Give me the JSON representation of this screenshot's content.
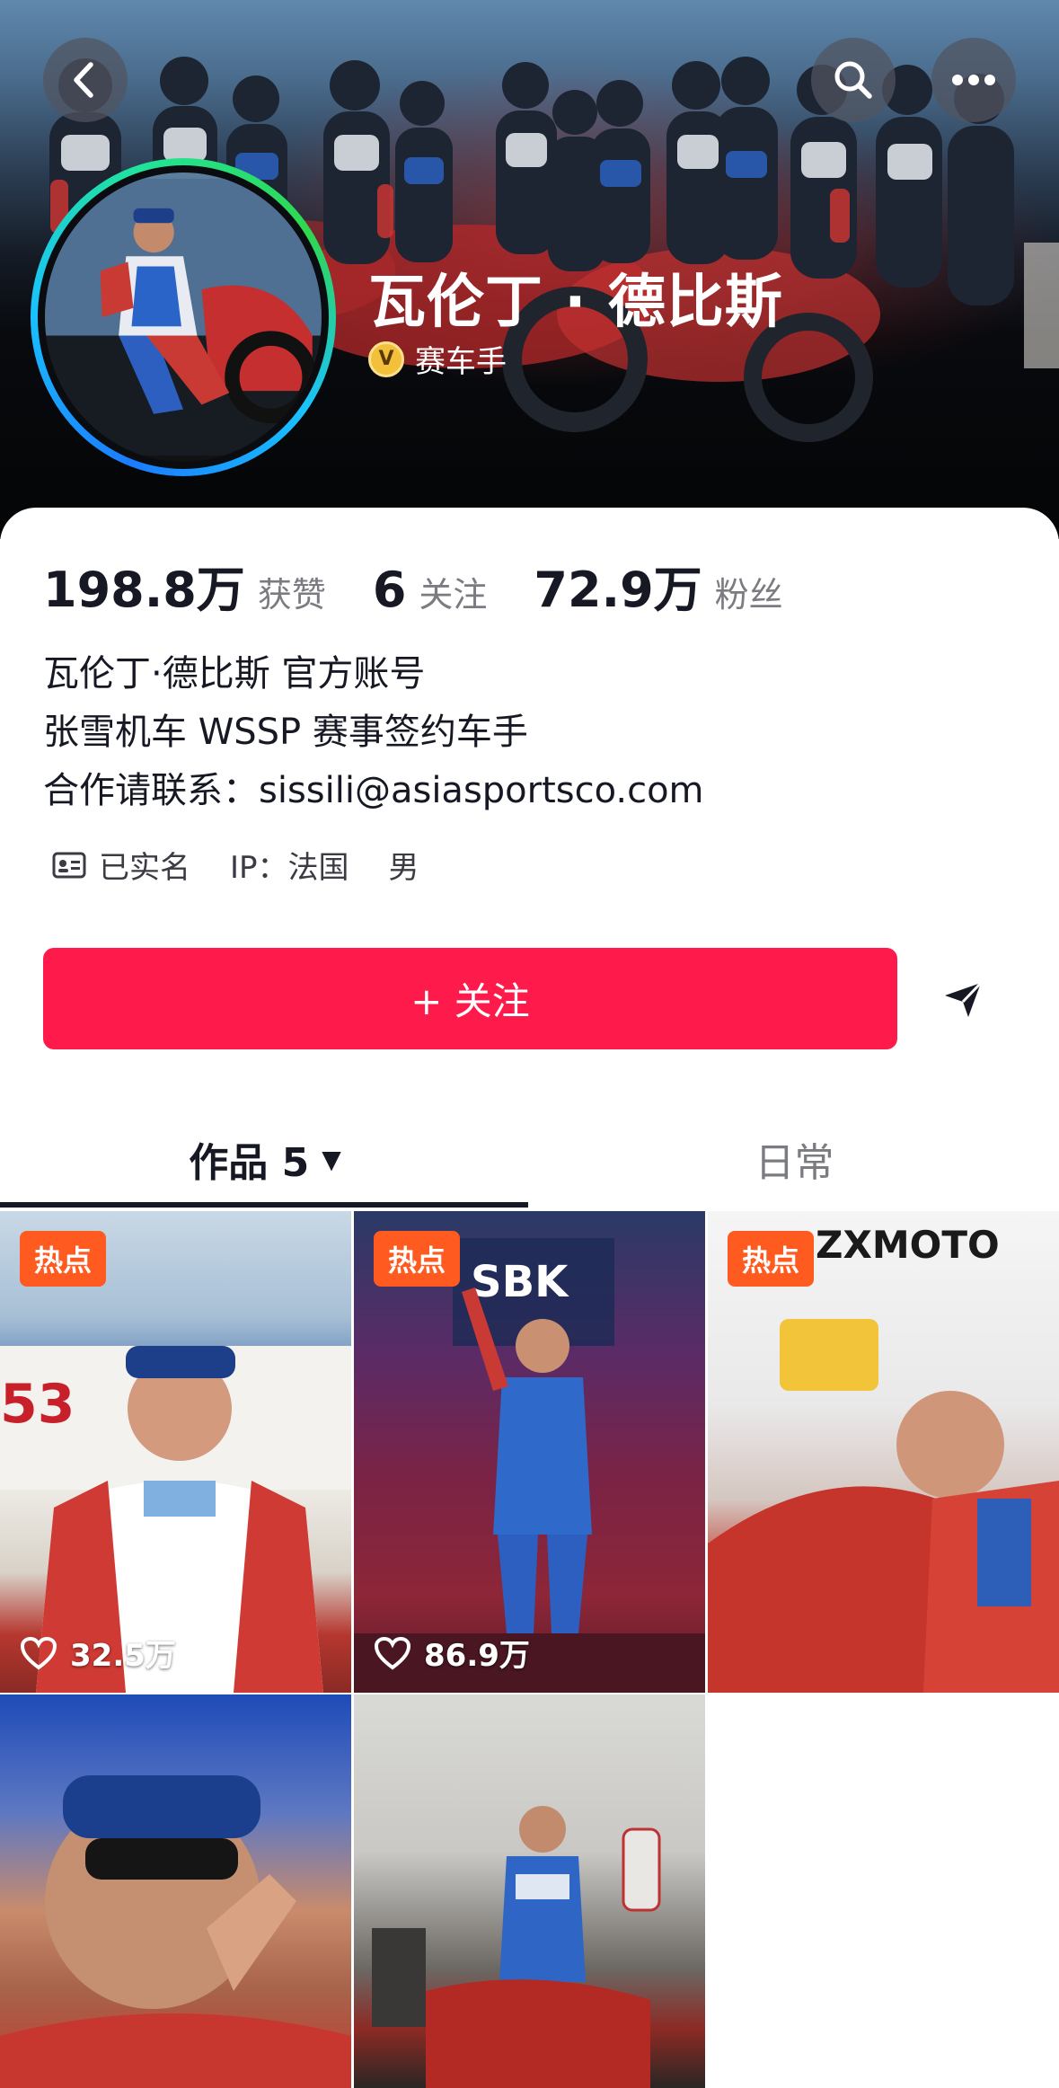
{
  "header": {
    "name": "瓦伦丁 · 德比斯",
    "verified_badge": "V",
    "verified_label": "赛车手"
  },
  "stats": [
    {
      "value": "198.8万",
      "label": "获赞"
    },
    {
      "value": "6",
      "label": "关注"
    },
    {
      "value": "72.9万",
      "label": "粉丝"
    }
  ],
  "bio": [
    "瓦伦丁·德比斯 官方账号",
    "张雪机车 WSSP 赛事签约车手",
    "合作请联系：sissili@asiasportsco.com"
  ],
  "meta": {
    "verified_name": "已实名",
    "ip": "IP：法国",
    "gender": "男"
  },
  "follow_button": "+ 关注",
  "tabs": {
    "works": "作品 5",
    "daily": "日常"
  },
  "videos": [
    {
      "hot": "热点",
      "likes": "32.5万"
    },
    {
      "hot": "热点",
      "likes": "86.9万"
    },
    {
      "hot": "热点",
      "likes": ""
    },
    {
      "hot": "",
      "likes": ""
    },
    {
      "hot": "",
      "likes": ""
    }
  ],
  "colors": {
    "follow_button": "#fe1a4a",
    "hot_tag": "#ff5a1f",
    "avatar_ring": "#19c2ff"
  }
}
